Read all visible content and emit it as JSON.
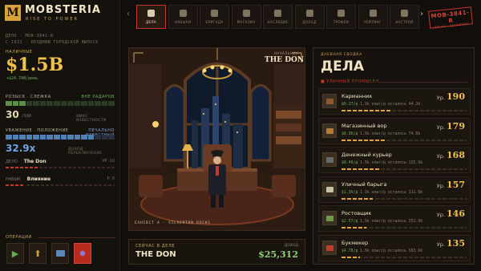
{
  "app": {
    "logo_letter": "M",
    "title": "MOBSTERIA",
    "subtitle": "RISE TO POWER"
  },
  "case_meta": {
    "line1": "ДЕЛО · MOB-3841-R",
    "line2": "С 1931 · ПОЗДНИЙ ГОРОДСКОЙ ВЫПУСК"
  },
  "cash": {
    "label": "НАЛИЧНЫЕ",
    "value": "$1.5B",
    "rate": "+$24.74B/день"
  },
  "heat": {
    "label": "РОЗЫСК · СЛЕЖКА",
    "status": "ВНЕ РАДАРОВ",
    "value": "30",
    "max": "/160",
    "note": "ФИКС ИЗВЕСТНОСТИ",
    "level_fraction": 0.19
  },
  "respect": {
    "label": "УВАЖЕНИЕ · ПОЛОЖЕНИЕ",
    "status": "ПЕЧАЛЬНО ИЗВЕСТНЫЙ",
    "value": "32.9x",
    "note": "ДОХОД · ПЕРЕКЛЮЧЕНИЕ",
    "level_fraction": 0.83
  },
  "rank": [
    {
      "key": "ДЕЛО",
      "value": "The Don",
      "extra": "УР. 10"
    },
    {
      "key": "НАВЫК",
      "value": "Влияние",
      "extra": "Р. 0"
    }
  ],
  "operations": {
    "label": "ОПЕРАЦИИ"
  },
  "nav": {
    "tabs": [
      {
        "label": "ДЕЛА",
        "active": true
      },
      {
        "label": "НАВЫКИ",
        "active": false
      },
      {
        "label": "БРИГАДА",
        "active": false
      },
      {
        "label": "МАГАЗИН",
        "active": false
      },
      {
        "label": "НАСЛЕДИЕ",
        "active": false
      },
      {
        "label": "ДОХОД",
        "active": false
      },
      {
        "label": "ТРОФЕИ",
        "active": false
      },
      {
        "label": "РЕЙТИНГ",
        "active": false
      },
      {
        "label": "НАСТРОЙ",
        "active": false
      }
    ],
    "badge_main": "MOB-3841-R",
    "badge_sub": "ДОСЬЕ · ОДОБРЕНО"
  },
  "scene": {
    "tag_small": "НАЧАЛЬНИК",
    "tag_title": "THE DON",
    "exhibit": "EXHIBIT A · SILVERTON DOCKS"
  },
  "now": {
    "label": "СЕЙЧАС В ДЕЛЕ",
    "name": "THE DON",
    "income_label": "ДОХОД",
    "income": "$25,312"
  },
  "jobs_panel": {
    "label": "ДНЕВНАЯ СВОДКА",
    "title": "ДЕЛА",
    "section": "УЛИЧНЫЙ ПРОМЫСЕЛ"
  },
  "jobs": [
    {
      "name": "Карманник",
      "level_prefix": "Ур.",
      "level": "190",
      "pay": "$0.17/д",
      "xp": "1.5k опыт/д",
      "left": "осталось 44.3k",
      "color": "#8c5a2e",
      "progress": 0.4
    },
    {
      "name": "Магазинный вор",
      "level_prefix": "Ур.",
      "level": "179",
      "pay": "$0.36/д",
      "xp": "1.5k опыт/д",
      "left": "осталось 74.8k",
      "color": "#b57b34",
      "progress": 0.35
    },
    {
      "name": "Денежный курьер",
      "level_prefix": "Ур.",
      "level": "168",
      "pay": "$0.49/д",
      "xp": "1.5k опыт/д",
      "left": "осталось 125.9k",
      "color": "#6a6a6a",
      "progress": 0.3
    },
    {
      "name": "Уличный барыга",
      "level_prefix": "Ур.",
      "level": "157",
      "pay": "$1.36/д",
      "xp": "1.5k опыт/д",
      "left": "осталось 211.8k",
      "color": "#c7c1a6",
      "progress": 0.25
    },
    {
      "name": "Ростовщик",
      "level_prefix": "Ур.",
      "level": "146",
      "pay": "$2.57/д",
      "xp": "1.5k опыт/д",
      "left": "осталось 351.9k",
      "color": "#6f9a4a",
      "progress": 0.2
    },
    {
      "name": "Букмекер",
      "level_prefix": "Ур.",
      "level": "135",
      "pay": "$4.78/д",
      "xp": "1.5k опыт/д",
      "left": "осталось 583.6k",
      "color": "#c23b2a",
      "progress": 0.15
    }
  ]
}
